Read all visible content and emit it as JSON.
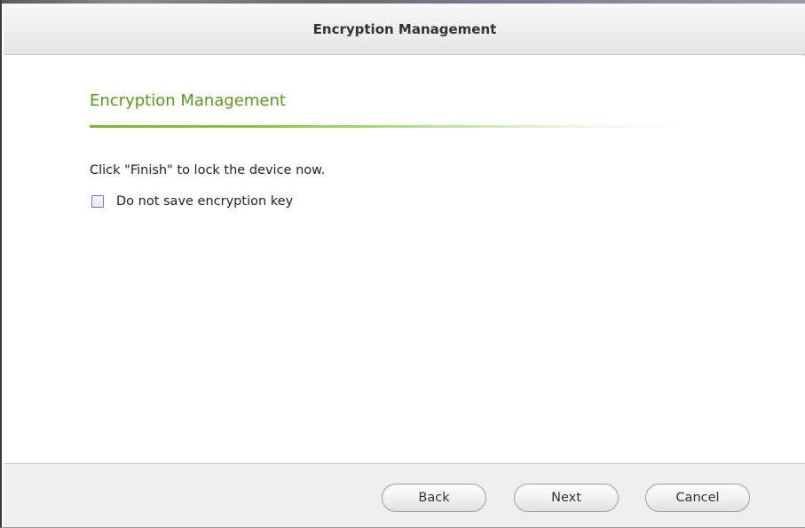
{
  "window": {
    "title": "Encryption Management"
  },
  "content": {
    "heading": "Encryption Management",
    "instruction": "Click \"Finish\" to lock the device now.",
    "checkbox": {
      "label": "Do not save encryption key",
      "checked": false
    }
  },
  "footer": {
    "back_label": "Back",
    "next_label": "Next",
    "cancel_label": "Cancel"
  },
  "colors": {
    "heading": "#5a9a15",
    "underline": "#7cb82b"
  }
}
